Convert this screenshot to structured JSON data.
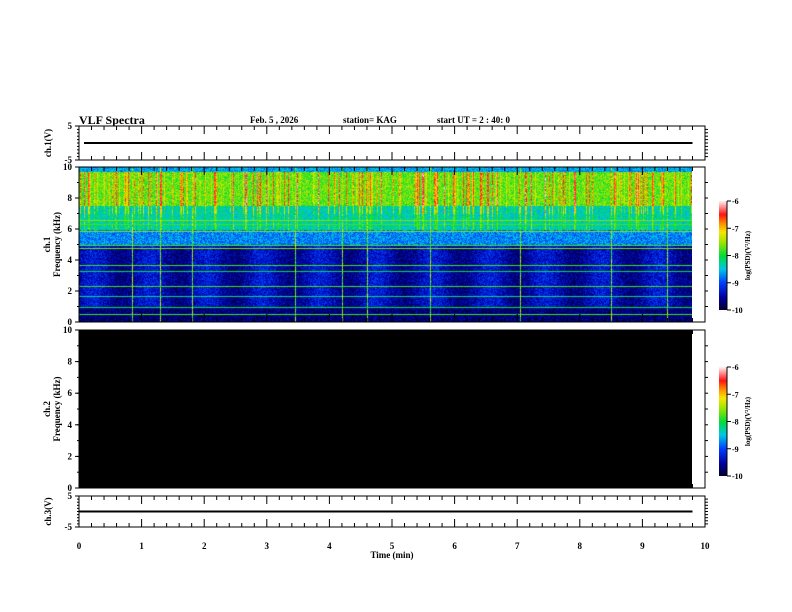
{
  "header": {
    "title": "VLF Spectra",
    "date": "Feb. 5  , 2026",
    "station": "station= KAG",
    "start": "start  UT =   2 : 40: 0"
  },
  "chart_data": [
    {
      "type": "line",
      "panel": "ch1-voltage",
      "ylabel": "ch.1(V)",
      "ylim": [
        -5,
        5
      ],
      "yticks": [
        "5",
        "-5"
      ],
      "xlim": [
        0,
        10
      ],
      "data_end": 9.8,
      "values_approx": 0.0
    },
    {
      "type": "heatmap",
      "panel": "ch1-spectrogram",
      "ylabel": "ch.1 Frequency (kHz)",
      "ylim": [
        0,
        10
      ],
      "yticks": [
        "0",
        "2",
        "4",
        "6",
        "8",
        "10"
      ],
      "xlim": [
        0,
        10
      ],
      "data_end": 9.8,
      "colorbar": {
        "label": "log(PSD)(V²/Hz)",
        "range": [
          -10,
          -6
        ],
        "ticks": [
          "-6",
          "-7",
          "-8",
          "-9",
          "-10"
        ]
      },
      "content": "active spectrogram"
    },
    {
      "type": "heatmap",
      "panel": "ch2-spectrogram",
      "ylabel": "ch.2 Frequency (kHz)",
      "ylim": [
        0,
        10
      ],
      "yticks": [
        "0",
        "2",
        "4",
        "6",
        "8",
        "10"
      ],
      "xlim": [
        0,
        10
      ],
      "data_end": 9.8,
      "colorbar": {
        "label": "log(PSD)(V²/Hz)",
        "range": [
          -10,
          -6
        ],
        "ticks": [
          "-6",
          "-7",
          "-8",
          "-9",
          "-10"
        ]
      },
      "content": "all black (no signal)"
    },
    {
      "type": "line",
      "panel": "ch3-voltage",
      "ylabel": "ch.3(V)",
      "ylim": [
        -5,
        5
      ],
      "yticks": [
        "5",
        "-5"
      ],
      "xlim": [
        0,
        10
      ],
      "data_end": 9.8,
      "values_approx": 0.0
    }
  ],
  "xaxis": {
    "label": "Time  (min)",
    "ticks": [
      "0",
      "1",
      "2",
      "3",
      "4",
      "5",
      "6",
      "7",
      "8",
      "9",
      "10"
    ]
  }
}
